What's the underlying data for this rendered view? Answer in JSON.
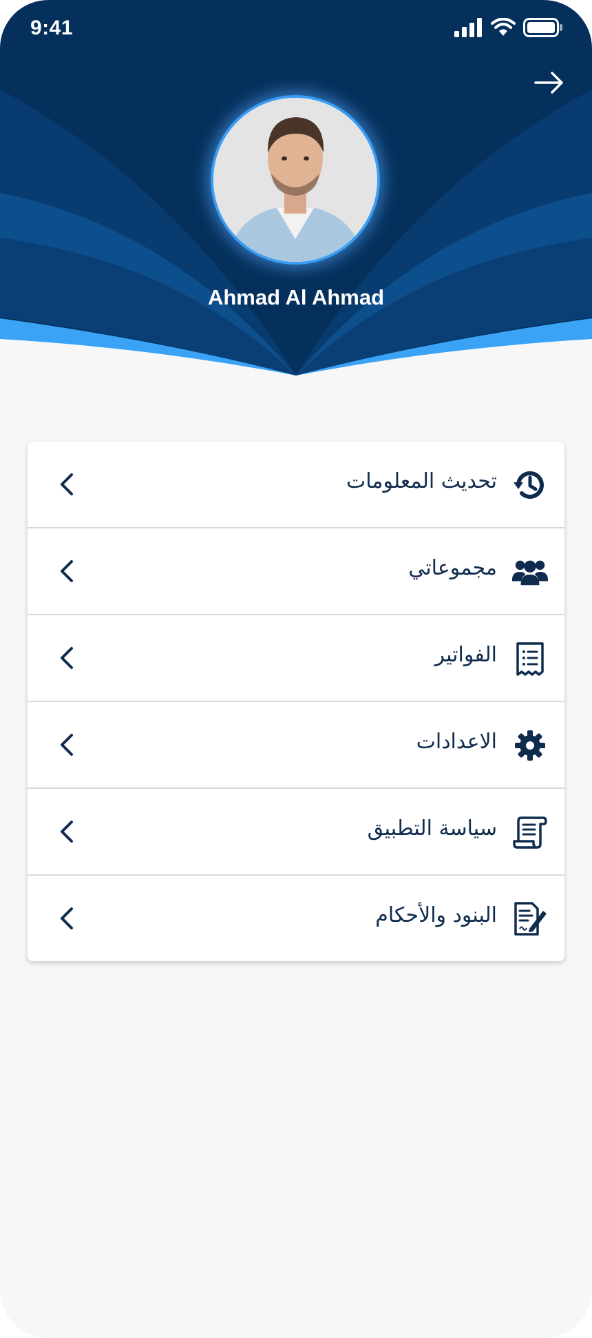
{
  "status_bar": {
    "time": "9:41"
  },
  "profile": {
    "name": "Ahmad Al Ahmad"
  },
  "menu": {
    "items": [
      {
        "label": "تحديث المعلومات",
        "icon": "history-icon"
      },
      {
        "label": "مجموعاتي",
        "icon": "users-group-icon"
      },
      {
        "label": "الفواتير",
        "icon": "invoice-icon"
      },
      {
        "label": "الاعدادات",
        "icon": "gear-icon"
      },
      {
        "label": "سياسة التطبيق",
        "icon": "scroll-icon"
      },
      {
        "label": "البنود والأحكام",
        "icon": "document-sign-icon"
      }
    ]
  },
  "colors": {
    "header_dark": "#05305c",
    "header_mid": "#0b4a86",
    "accent_blue": "#3aa3f5",
    "text_dark": "#0f2b4d",
    "background": "#f7f7f7"
  }
}
